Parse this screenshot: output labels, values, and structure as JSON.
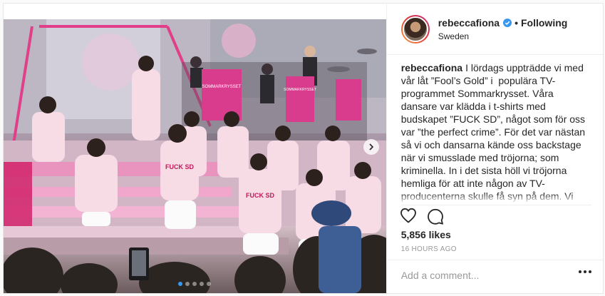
{
  "post": {
    "username": "rebeccafiona",
    "verified": true,
    "separator": "•",
    "follow_status": "Following",
    "location": "Sweden",
    "caption": "I lördags uppträdde vi med vår låt ”Fool’s Gold” i  populära TV-programmet Sommarkrysset. Våra dansare var klädda i t-shirts med budskapet ”FUCK SD”, något som för oss var ”the perfect crime”. För det var nästan så vi och dansarna kände oss backstage när vi smusslade med tröjorna; som kriminella. In i det sista höll vi tröjorna hemliga för att inte någon av TV-producenterna skulle få syn på dem. Vi lever ju i en tid då rasism är så pass normaliserat att vi vet att det blivit",
    "likes": "5,856 likes",
    "timestamp": "16 HOURS AGO",
    "comment_placeholder": "Add a comment...",
    "carousel": {
      "slides": 5,
      "active_index": 0
    }
  },
  "photo": {
    "stage_signs": [
      "SOMMARKRYSSET",
      "SOMMARKRYSSET"
    ],
    "shirt_text": "FUCK SD"
  },
  "colors": {
    "accent": "#3897f0",
    "text": "#262626",
    "muted": "#999999",
    "shirt_pink": "#f4c6d6",
    "stage_pink": "#e23f8a"
  },
  "icons": [
    "verified-badge-icon",
    "heart-icon",
    "comment-icon",
    "more-options-icon",
    "chevron-right-icon"
  ]
}
